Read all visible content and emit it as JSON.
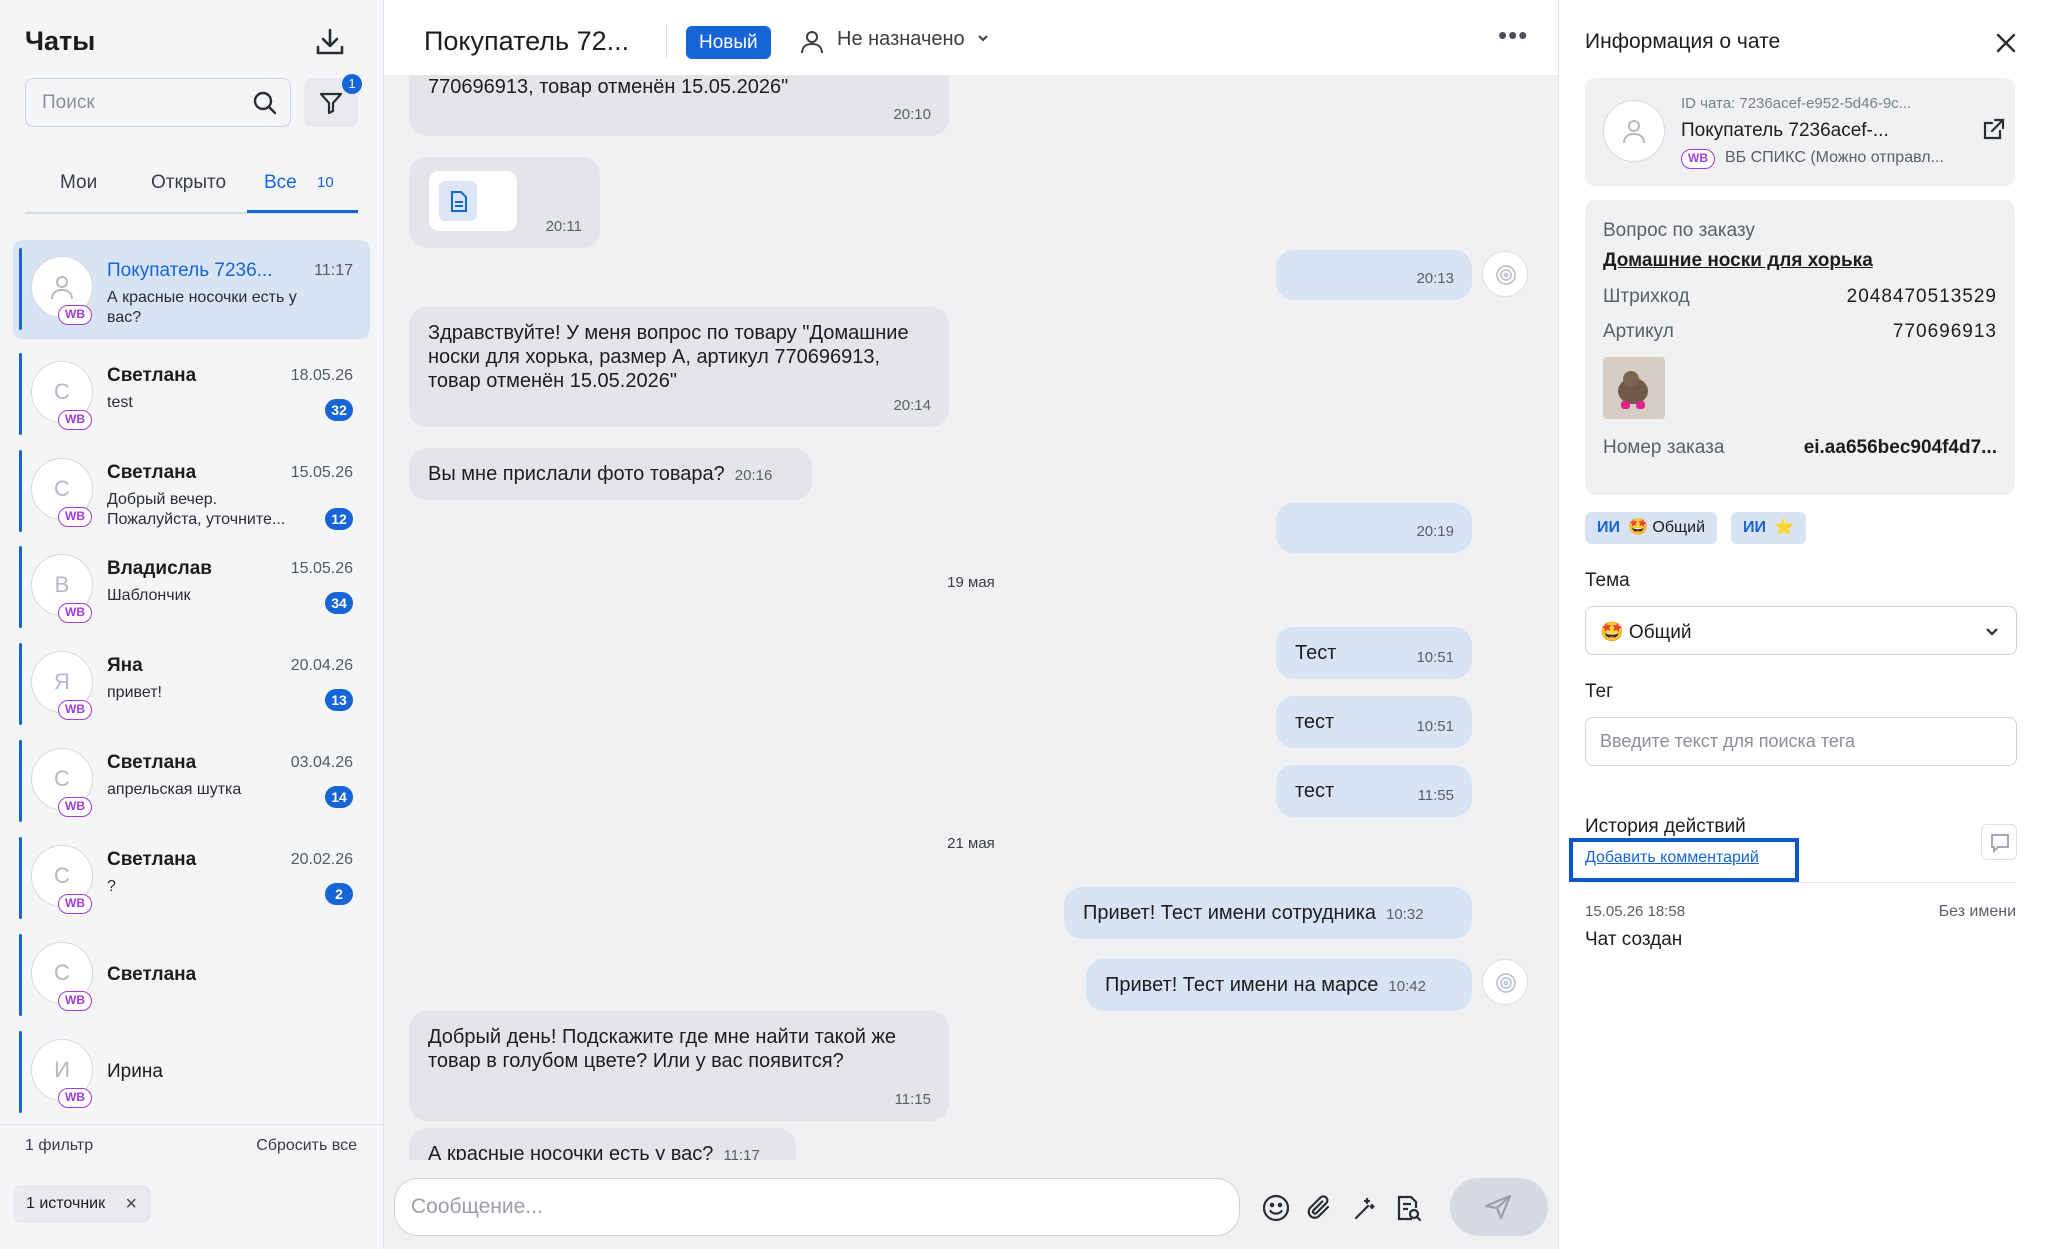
{
  "sidebar": {
    "title": "Чаты",
    "search_placeholder": "Поиск",
    "filter_badge": "1",
    "tabs": [
      {
        "label": "Мои"
      },
      {
        "label": "Открыто"
      },
      {
        "label": "Все",
        "count": "10"
      }
    ],
    "chats": [
      {
        "name": "Покупатель 7236...",
        "time": "11:17",
        "preview": "А красные носочки есть у вас?",
        "avatar": "",
        "badge": "",
        "active": true
      },
      {
        "name": "Светлана",
        "time": "18.05.26",
        "preview": "test",
        "avatar": "С",
        "badge": "32"
      },
      {
        "name": "Светлана",
        "time": "15.05.26",
        "preview": "Добрый вечер. Пожалуйста, уточните...",
        "avatar": "С",
        "badge": "12"
      },
      {
        "name": "Владислав",
        "time": "15.05.26",
        "preview": "Шаблончик",
        "avatar": "В",
        "badge": "34"
      },
      {
        "name": "Яна",
        "time": "20.04.26",
        "preview": "привет!",
        "avatar": "Я",
        "badge": "13"
      },
      {
        "name": "Светлана",
        "time": "03.04.26",
        "preview": "апрельская шутка",
        "avatar": "С",
        "badge": "14"
      },
      {
        "name": "Светлана",
        "time": "20.02.26",
        "preview": "?",
        "avatar": "С",
        "badge": "2"
      },
      {
        "name": "Светлана",
        "time": "",
        "preview": "",
        "avatar": "С",
        "badge": ""
      },
      {
        "name": "Ирина",
        "time": "",
        "preview": "",
        "avatar": "И",
        "badge": ""
      }
    ],
    "wb_label": "WB",
    "filter_count": "1 фильтр",
    "reset_all": "Сбросить все",
    "source_chip": "1 источник"
  },
  "header": {
    "title": "Покупатель 72...",
    "status": "Новый",
    "assignee": "Не назначено"
  },
  "messages": {
    "m1_text": "770696913, товар отменён 15.05.2026\"",
    "m1_time": "20:10",
    "m2_time": "20:11",
    "m3_time": "20:13",
    "m4_text": "Здравствуйте! У меня вопрос по товару \"Домашние носки для хорька, размер А, артикул 770696913, товар отменён 15.05.2026\"",
    "m4_time": "20:14",
    "m5_text": "Вы мне прислали фото товара?",
    "m5_time": "20:16",
    "m6_time": "20:19",
    "day1": "19 мая",
    "m7_text": "Тест",
    "m7_time": "10:51",
    "m8_text": "тест",
    "m8_time": "10:51",
    "m9_text": "тест",
    "m9_time": "11:55",
    "day2": "21 мая",
    "m10_text": "Привет! Тест имени сотрудника",
    "m10_time": "10:32",
    "m11_text": "Привет! Тест имени на марсе",
    "m11_time": "10:42",
    "m12_text": "Добрый день! Подскажите где мне найти такой же товар в голубом цвете? Или у вас появится?",
    "m12_time": "11:15",
    "m13_text": "А красные носочки есть у вас?",
    "m13_time": "11:17"
  },
  "composer": {
    "placeholder": "Сообщение..."
  },
  "info": {
    "title": "Информация о чате",
    "chat_id": "ID чата: 7236acef-e952-5d46-9c...",
    "name": "Покупатель 7236acef-...",
    "wb": "WB",
    "source": "ВБ СПИКС (Можно отправл...",
    "order_heading": "Вопрос по заказу",
    "product": "Домашние носки для хорька",
    "barcode_label": "Штрихкод",
    "barcode": "2048470513529",
    "article_label": "Артикул",
    "article": "770696913",
    "order_label": "Номер заказа",
    "order": "ei.aa656bec904f4d7...",
    "chips": [
      {
        "ai": "ИИ",
        "text": "🤩 Общий"
      },
      {
        "ai": "ИИ",
        "text": "⭐"
      }
    ],
    "topic_label": "Тема",
    "topic_value": "🤩 Общий",
    "tag_label": "Тег",
    "tag_placeholder": "Введите текст для поиска тега",
    "history_title": "История действий",
    "add_comment": "Добавить комментарий",
    "event_date": "15.05.26 18:58",
    "event_who": "Без имени",
    "event_text": "Чат создан"
  }
}
